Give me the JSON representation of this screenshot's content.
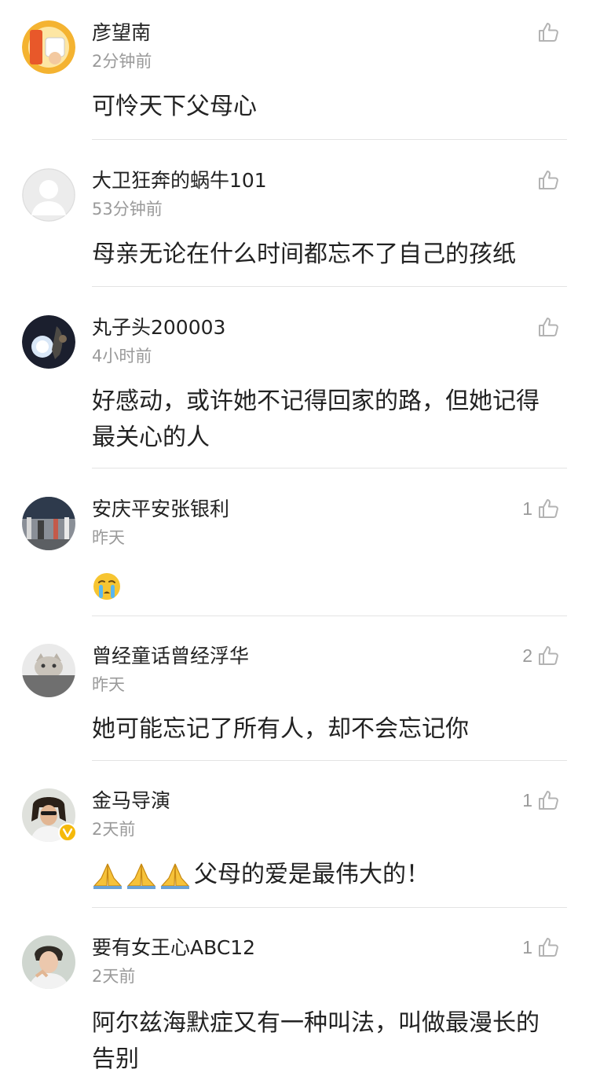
{
  "comments": [
    {
      "username": "彦望南",
      "time": "2分钟前",
      "likes": "",
      "text": "可怜天下父母心"
    },
    {
      "username": "大卫狂奔的蜗牛101",
      "time": "53分钟前",
      "likes": "",
      "text": "母亲无论在什么时间都忘不了自己的孩纸"
    },
    {
      "username": "丸子头200003",
      "time": "4小时前",
      "likes": "",
      "text": "好感动，或许她不记得回家的路，但她记得最关心的人"
    },
    {
      "username": "安庆平安张银利",
      "time": "昨天",
      "likes": "1",
      "text": "",
      "text_emoji": "crying-face-emoji"
    },
    {
      "username": "曾经童话曾经浮华",
      "time": "昨天",
      "likes": "2",
      "text": "她可能忘记了所有人，却不会忘记你"
    },
    {
      "username": "金马导演",
      "time": "2天前",
      "likes": "1",
      "text": "父母的爱是最伟大的！",
      "text_emoji": "folded-hands-emoji",
      "verified": true
    },
    {
      "username": "要有女王心ABC12",
      "time": "2天前",
      "likes": "1",
      "text": "阿尔兹海默症又有一种叫法，叫做最漫长的告别"
    }
  ],
  "colors": {
    "text": "#222222",
    "secondary": "#9a9a9a",
    "divider": "#e3e3e3",
    "verified": "#f5b90a"
  },
  "icons": {
    "like": "thumbs-up-outline-icon",
    "verified": "verified-v-icon"
  }
}
